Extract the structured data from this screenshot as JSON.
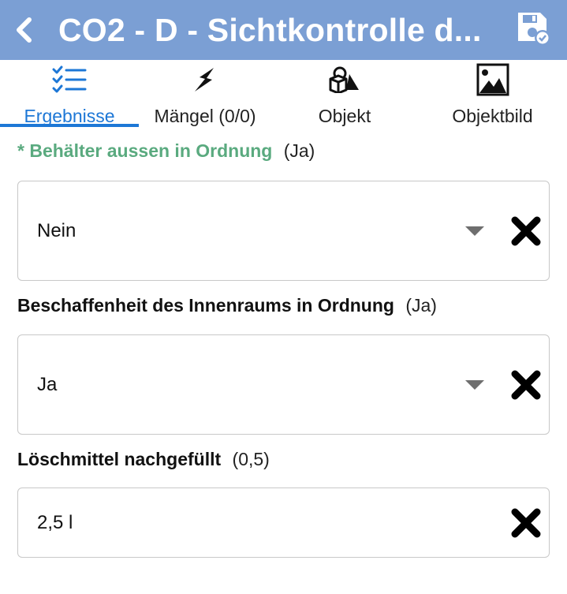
{
  "header": {
    "title": "CO2 - D - Sichtkontrolle d...",
    "back_icon": "chevron-left-icon",
    "save_icon": "save-check-icon"
  },
  "tabs": [
    {
      "label": "Ergebnisse",
      "icon": "checklist-icon",
      "active": true
    },
    {
      "label": "Mängel (0/0)",
      "icon": "lightning-icon",
      "active": false
    },
    {
      "label": "Objekt",
      "icon": "shapes-icon",
      "active": false
    },
    {
      "label": "Objektbild",
      "icon": "image-icon",
      "active": false
    }
  ],
  "fields": [
    {
      "label": "Behälter aussen in Ordnung",
      "required_marker": "*",
      "hint": "(Ja)",
      "value": "Nein",
      "type": "select"
    },
    {
      "label": "Beschaffenheit des Innenraums in Ordnung",
      "hint": "(Ja)",
      "value": "Ja",
      "type": "select"
    },
    {
      "label": "Löschmittel nachgefüllt",
      "hint": "(0,5)",
      "value": "2,5 l",
      "type": "text"
    }
  ],
  "colors": {
    "appbar": "#7b9fd4",
    "accent": "#1d77d6",
    "required": "#5aaa7f"
  }
}
